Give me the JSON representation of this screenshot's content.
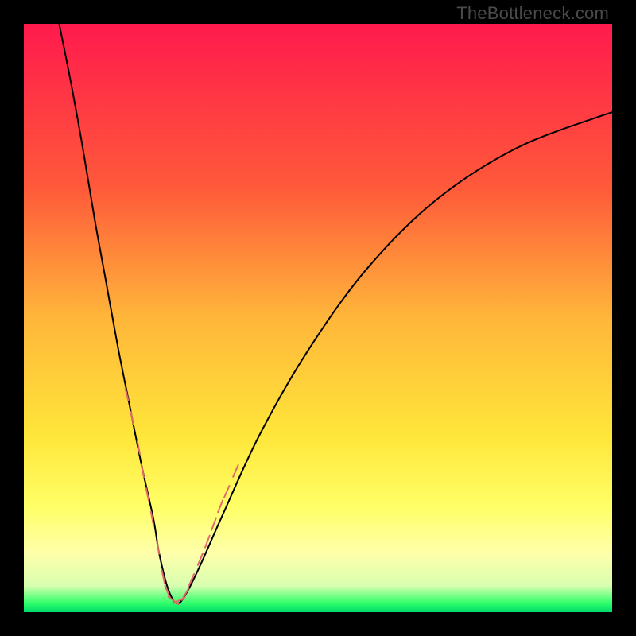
{
  "watermark": "TheBottleneck.com",
  "gradient": {
    "stops": [
      {
        "offset": 0.0,
        "color": "#ff1a4d"
      },
      {
        "offset": 0.28,
        "color": "#ff5a3a"
      },
      {
        "offset": 0.5,
        "color": "#ffb63a"
      },
      {
        "offset": 0.7,
        "color": "#ffe63a"
      },
      {
        "offset": 0.82,
        "color": "#ffff66"
      },
      {
        "offset": 0.9,
        "color": "#ffffaa"
      },
      {
        "offset": 0.955,
        "color": "#d8ffb0"
      },
      {
        "offset": 0.985,
        "color": "#2eff6a"
      },
      {
        "offset": 1.0,
        "color": "#00d96c"
      }
    ]
  },
  "chart_data": {
    "type": "line",
    "title": "",
    "xlabel": "",
    "ylabel": "",
    "xlim": [
      0,
      100
    ],
    "ylim": [
      0,
      100
    ],
    "grid": false,
    "legend": false,
    "series": [
      {
        "name": "bottleneck-curve",
        "x": [
          6,
          8,
          10,
          12,
          14,
          16,
          18,
          20,
          22,
          23,
          24.5,
          26,
          27.5,
          30,
          34,
          40,
          48,
          58,
          70,
          84,
          100
        ],
        "values": [
          100,
          90,
          79,
          67,
          56,
          45,
          35,
          25,
          16,
          10,
          4,
          1.5,
          3,
          8,
          17,
          30,
          44,
          58,
          70,
          79,
          85
        ]
      }
    ],
    "markers": {
      "name": "highlight-points",
      "color": "#e26a6a",
      "points": [
        {
          "x": 17.5,
          "y": 37
        },
        {
          "x": 18.4,
          "y": 33
        },
        {
          "x": 19.5,
          "y": 28
        },
        {
          "x": 20.2,
          "y": 24
        },
        {
          "x": 21.0,
          "y": 20
        },
        {
          "x": 21.8,
          "y": 16
        },
        {
          "x": 22.8,
          "y": 11
        },
        {
          "x": 23.7,
          "y": 6
        },
        {
          "x": 24.4,
          "y": 3.5
        },
        {
          "x": 25.4,
          "y": 2
        },
        {
          "x": 26.4,
          "y": 2
        },
        {
          "x": 27.4,
          "y": 3
        },
        {
          "x": 28.5,
          "y": 5.5
        },
        {
          "x": 30.0,
          "y": 9
        },
        {
          "x": 31.2,
          "y": 12
        },
        {
          "x": 32.3,
          "y": 15
        },
        {
          "x": 33.4,
          "y": 18
        },
        {
          "x": 34.5,
          "y": 20.5
        },
        {
          "x": 36.0,
          "y": 24
        }
      ]
    }
  }
}
